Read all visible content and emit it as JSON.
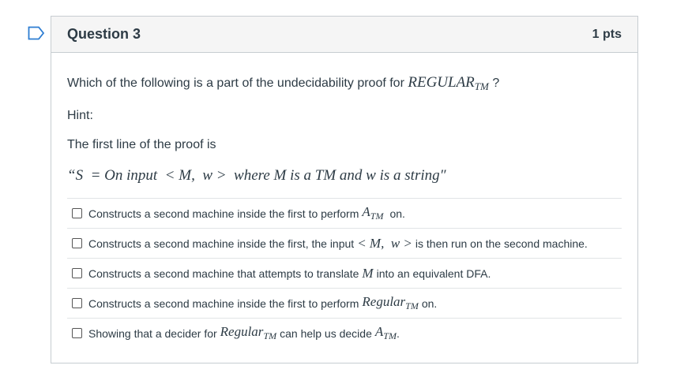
{
  "question": {
    "title": "Question 3",
    "points": "1 pts",
    "prompt_text": "Which of the following is a part of the undecidability proof for",
    "prompt_math": "REGULAR",
    "prompt_math_sub": "TM",
    "prompt_end": "?",
    "hint": "Hint:",
    "first_line_intro": "The first line of the proof is",
    "first_line_math": "“S  = On input  < M,  w >  where M is a TM and w is a string″"
  },
  "answers": [
    {
      "pre": "Constructs a second machine inside the first to perform",
      "math": "A",
      "sub": "TM",
      "post": "on."
    },
    {
      "pre": "Constructs a second machine inside the first, the input",
      "math": "< M,  w >",
      "sub": "",
      "post": "is then run on the second machine."
    },
    {
      "pre": "Constructs a second machine that attempts to translate",
      "math": "M",
      "sub": "",
      "post": "into an equivalent DFA."
    },
    {
      "pre": "Constructs a second machine inside the first to perform",
      "math": "Regular",
      "sub": "TM",
      "post": "on."
    },
    {
      "pre": "Showing that a decider for",
      "math": "Regular",
      "sub": "TM",
      "post": "can help us decide",
      "math2": "A",
      "sub2": "TM",
      "post2": "."
    }
  ]
}
